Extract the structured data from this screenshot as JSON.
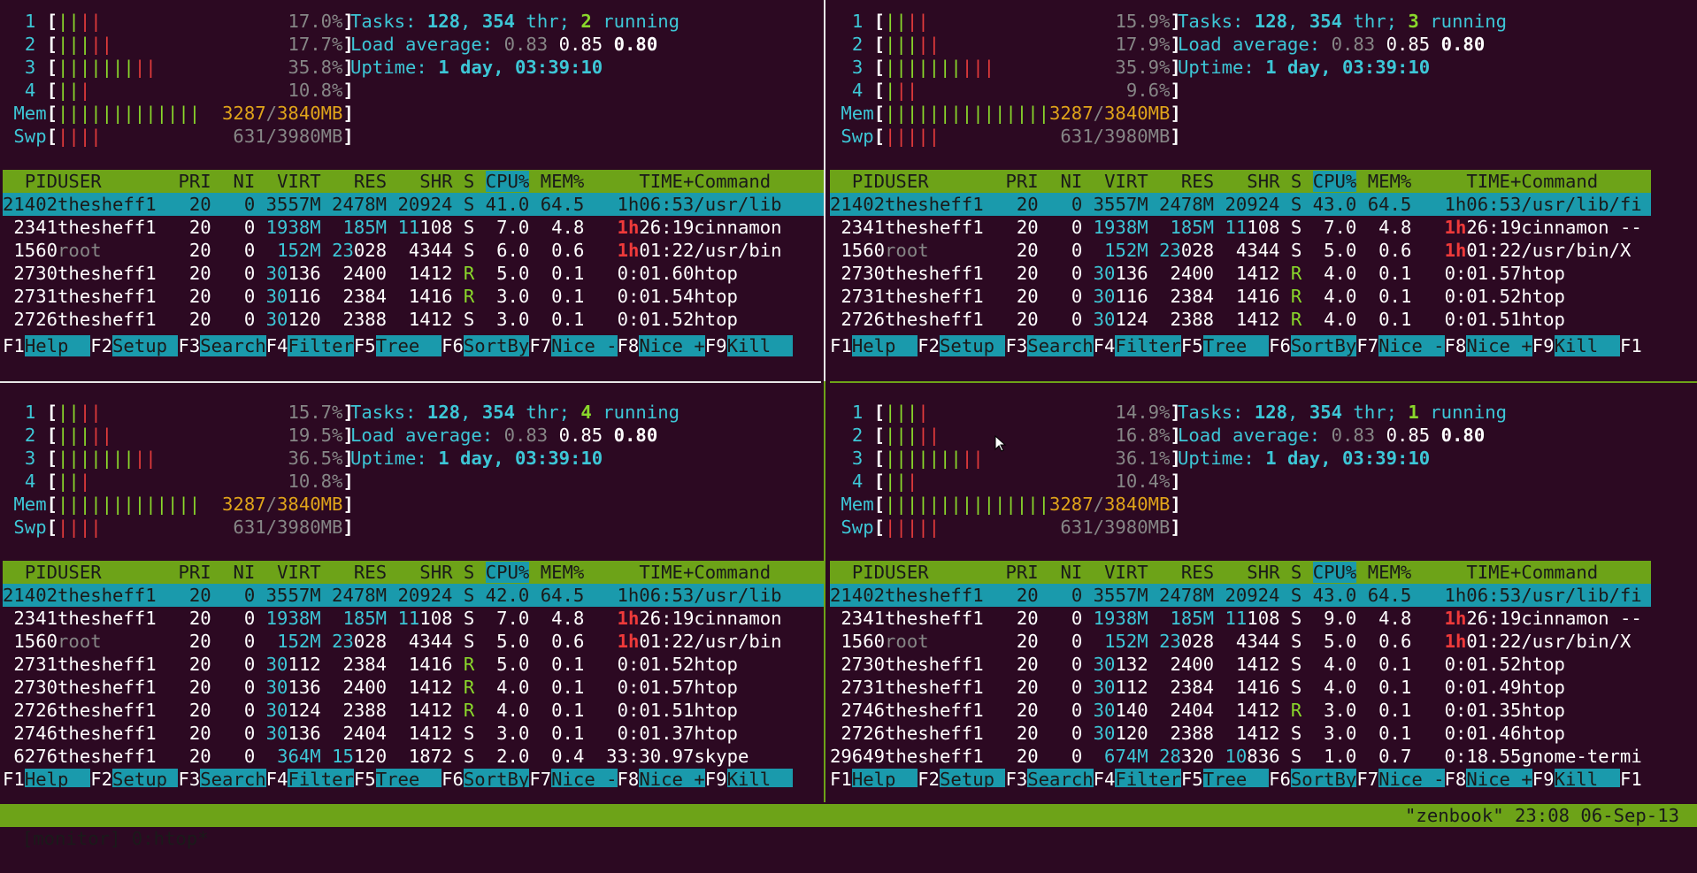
{
  "panes": [
    {
      "cpus": [
        {
          "num": "1",
          "bar": [
            [
              "g",
              "||"
            ],
            [
              "r",
              "||"
            ]
          ],
          "val": "17.0%"
        },
        {
          "num": "2",
          "bar": [
            [
              "g",
              "|||"
            ],
            [
              "r",
              "||"
            ]
          ],
          "val": "17.7%"
        },
        {
          "num": "3",
          "bar": [
            [
              "g",
              "|||||||"
            ],
            [
              "r",
              "||"
            ]
          ],
          "val": "35.8%"
        },
        {
          "num": "4",
          "bar": [
            [
              "g",
              "||"
            ],
            [
              "r",
              "|"
            ]
          ],
          "val": "10.8%"
        }
      ],
      "mem": {
        "label": "Mem",
        "bar": "|||||||||||||",
        "used": "3287",
        "sep": "/",
        "total": "3840",
        "unit": "MB"
      },
      "swp": {
        "label": "Swp",
        "bar": "||||",
        "val": "631/3980MB"
      },
      "tasks": {
        "label": "Tasks: ",
        "tasks": "128",
        "comma": ", ",
        "thr": "354",
        "thr_label": " thr; ",
        "running": "2",
        "running_label": " running"
      },
      "load": {
        "label": "Load average: ",
        "a1": "0.83",
        "a5": "0.85",
        "a15": "0.80"
      },
      "uptime": {
        "label": "Uptime: ",
        "val": "1 day, 03:39:10"
      },
      "rows": [
        {
          "pid": "21402",
          "user": "thesheff1",
          "pri": "20",
          "ni": "0",
          "virt": "3557M",
          "res": "2478M",
          "shr": "20924",
          "s": "S",
          "cpu": "41.0",
          "mem": "64.5",
          "time": "1h06:53",
          "cmd": "/usr/lib"
        },
        {
          "pid": "2341",
          "user": "thesheff1",
          "pri": "20",
          "ni": "0",
          "virt": "1938M",
          "res": "185M",
          "shr": "11108",
          "s": "S",
          "cpu": "7.0",
          "mem": "4.8",
          "time": "1h26:19",
          "cmd": "cinnamon"
        },
        {
          "pid": "1560",
          "user": "root",
          "pri": "20",
          "ni": "0",
          "virt": "152M",
          "res": "23028",
          "shr": "4344",
          "s": "S",
          "cpu": "6.0",
          "mem": "0.6",
          "time": "1h01:22",
          "cmd": "/usr/bin"
        },
        {
          "pid": "2730",
          "user": "thesheff1",
          "pri": "20",
          "ni": "0",
          "virt": "30136",
          "res": "2400",
          "shr": "1412",
          "s": "R",
          "cpu": "5.0",
          "mem": "0.1",
          "time": "0:01.60",
          "cmd": "htop"
        },
        {
          "pid": "2731",
          "user": "thesheff1",
          "pri": "20",
          "ni": "0",
          "virt": "30116",
          "res": "2384",
          "shr": "1416",
          "s": "R",
          "cpu": "3.0",
          "mem": "0.1",
          "time": "0:01.54",
          "cmd": "htop"
        },
        {
          "pid": "2726",
          "user": "thesheff1",
          "pri": "20",
          "ni": "0",
          "virt": "30120",
          "res": "2388",
          "shr": "1412",
          "s": "S",
          "cpu": "3.0",
          "mem": "0.1",
          "time": "0:01.52",
          "cmd": "htop"
        }
      ]
    },
    {
      "cpus": [
        {
          "num": "1",
          "bar": [
            [
              "g",
              "||"
            ],
            [
              "r",
              "||"
            ]
          ],
          "val": "15.9%"
        },
        {
          "num": "2",
          "bar": [
            [
              "g",
              "|||"
            ],
            [
              "r",
              "||"
            ]
          ],
          "val": "17.9%"
        },
        {
          "num": "3",
          "bar": [
            [
              "g",
              "|||||||"
            ],
            [
              "r",
              "|||"
            ]
          ],
          "val": "35.9%"
        },
        {
          "num": "4",
          "bar": [
            [
              "g",
              "|"
            ],
            [
              "r",
              "||"
            ]
          ],
          "val": "9.6%"
        }
      ],
      "mem": {
        "label": "Mem",
        "bar": "|||||||||||||||",
        "used": "3287",
        "sep": "/",
        "total": "3840",
        "unit": "MB"
      },
      "swp": {
        "label": "Swp",
        "bar": "|||||",
        "val": "631/3980MB"
      },
      "tasks": {
        "label": "Tasks: ",
        "tasks": "128",
        "comma": ", ",
        "thr": "354",
        "thr_label": " thr; ",
        "running": "3",
        "running_label": " running"
      },
      "load": {
        "label": "Load average: ",
        "a1": "0.83",
        "a5": "0.85",
        "a15": "0.80"
      },
      "uptime": {
        "label": "Uptime: ",
        "val": "1 day, 03:39:10"
      },
      "rows": [
        {
          "pid": "21402",
          "user": "thesheff1",
          "pri": "20",
          "ni": "0",
          "virt": "3557M",
          "res": "2478M",
          "shr": "20924",
          "s": "S",
          "cpu": "43.0",
          "mem": "64.5",
          "time": "1h06:53",
          "cmd": "/usr/lib/fi"
        },
        {
          "pid": "2341",
          "user": "thesheff1",
          "pri": "20",
          "ni": "0",
          "virt": "1938M",
          "res": "185M",
          "shr": "11108",
          "s": "S",
          "cpu": "7.0",
          "mem": "4.8",
          "time": "1h26:19",
          "cmd": "cinnamon --"
        },
        {
          "pid": "1560",
          "user": "root",
          "pri": "20",
          "ni": "0",
          "virt": "152M",
          "res": "23028",
          "shr": "4344",
          "s": "S",
          "cpu": "5.0",
          "mem": "0.6",
          "time": "1h01:22",
          "cmd": "/usr/bin/X"
        },
        {
          "pid": "2730",
          "user": "thesheff1",
          "pri": "20",
          "ni": "0",
          "virt": "30136",
          "res": "2400",
          "shr": "1412",
          "s": "R",
          "cpu": "4.0",
          "mem": "0.1",
          "time": "0:01.57",
          "cmd": "htop"
        },
        {
          "pid": "2731",
          "user": "thesheff1",
          "pri": "20",
          "ni": "0",
          "virt": "30116",
          "res": "2384",
          "shr": "1416",
          "s": "R",
          "cpu": "4.0",
          "mem": "0.1",
          "time": "0:01.52",
          "cmd": "htop"
        },
        {
          "pid": "2726",
          "user": "thesheff1",
          "pri": "20",
          "ni": "0",
          "virt": "30124",
          "res": "2388",
          "shr": "1412",
          "s": "R",
          "cpu": "4.0",
          "mem": "0.1",
          "time": "0:01.51",
          "cmd": "htop"
        }
      ]
    },
    {
      "cpus": [
        {
          "num": "1",
          "bar": [
            [
              "g",
              "||"
            ],
            [
              "r",
              "||"
            ]
          ],
          "val": "15.7%"
        },
        {
          "num": "2",
          "bar": [
            [
              "g",
              "|||"
            ],
            [
              "r",
              "||"
            ]
          ],
          "val": "19.5%"
        },
        {
          "num": "3",
          "bar": [
            [
              "g",
              "|||||||"
            ],
            [
              "r",
              "||"
            ]
          ],
          "val": "36.5%"
        },
        {
          "num": "4",
          "bar": [
            [
              "g",
              "||"
            ],
            [
              "r",
              "|"
            ]
          ],
          "val": "10.8%"
        }
      ],
      "mem": {
        "label": "Mem",
        "bar": "|||||||||||||",
        "used": "3287",
        "sep": "/",
        "total": "3840",
        "unit": "MB"
      },
      "swp": {
        "label": "Swp",
        "bar": "||||",
        "val": "631/3980MB"
      },
      "tasks": {
        "label": "Tasks: ",
        "tasks": "128",
        "comma": ", ",
        "thr": "354",
        "thr_label": " thr; ",
        "running": "4",
        "running_label": " running"
      },
      "load": {
        "label": "Load average: ",
        "a1": "0.83",
        "a5": "0.85",
        "a15": "0.80"
      },
      "uptime": {
        "label": "Uptime: ",
        "val": "1 day, 03:39:10"
      },
      "rows": [
        {
          "pid": "21402",
          "user": "thesheff1",
          "pri": "20",
          "ni": "0",
          "virt": "3557M",
          "res": "2478M",
          "shr": "20924",
          "s": "S",
          "cpu": "42.0",
          "mem": "64.5",
          "time": "1h06:53",
          "cmd": "/usr/lib"
        },
        {
          "pid": "2341",
          "user": "thesheff1",
          "pri": "20",
          "ni": "0",
          "virt": "1938M",
          "res": "185M",
          "shr": "11108",
          "s": "S",
          "cpu": "7.0",
          "mem": "4.8",
          "time": "1h26:19",
          "cmd": "cinnamon"
        },
        {
          "pid": "1560",
          "user": "root",
          "pri": "20",
          "ni": "0",
          "virt": "152M",
          "res": "23028",
          "shr": "4344",
          "s": "S",
          "cpu": "5.0",
          "mem": "0.6",
          "time": "1h01:22",
          "cmd": "/usr/bin"
        },
        {
          "pid": "2731",
          "user": "thesheff1",
          "pri": "20",
          "ni": "0",
          "virt": "30112",
          "res": "2384",
          "shr": "1416",
          "s": "R",
          "cpu": "5.0",
          "mem": "0.1",
          "time": "0:01.52",
          "cmd": "htop"
        },
        {
          "pid": "2730",
          "user": "thesheff1",
          "pri": "20",
          "ni": "0",
          "virt": "30136",
          "res": "2400",
          "shr": "1412",
          "s": "R",
          "cpu": "4.0",
          "mem": "0.1",
          "time": "0:01.57",
          "cmd": "htop"
        },
        {
          "pid": "2726",
          "user": "thesheff1",
          "pri": "20",
          "ni": "0",
          "virt": "30124",
          "res": "2388",
          "shr": "1412",
          "s": "R",
          "cpu": "4.0",
          "mem": "0.1",
          "time": "0:01.51",
          "cmd": "htop"
        },
        {
          "pid": "2746",
          "user": "thesheff1",
          "pri": "20",
          "ni": "0",
          "virt": "30136",
          "res": "2404",
          "shr": "1412",
          "s": "S",
          "cpu": "3.0",
          "mem": "0.1",
          "time": "0:01.37",
          "cmd": "htop"
        },
        {
          "pid": "6276",
          "user": "thesheff1",
          "pri": "20",
          "ni": "0",
          "virt": "364M",
          "res": "15120",
          "shr": "1872",
          "s": "S",
          "cpu": "2.0",
          "mem": "0.4",
          "time": "33:30.97",
          "cmd": "skype"
        }
      ]
    },
    {
      "cpus": [
        {
          "num": "1",
          "bar": [
            [
              "g",
              "|||"
            ],
            [
              "r",
              "|"
            ]
          ],
          "val": "14.9%"
        },
        {
          "num": "2",
          "bar": [
            [
              "g",
              "|||"
            ],
            [
              "r",
              "||"
            ]
          ],
          "val": "16.8%"
        },
        {
          "num": "3",
          "bar": [
            [
              "g",
              "|||||||"
            ],
            [
              "r",
              "||"
            ]
          ],
          "val": "36.1%"
        },
        {
          "num": "4",
          "bar": [
            [
              "g",
              "||"
            ],
            [
              "r",
              "|"
            ]
          ],
          "val": "10.4%"
        }
      ],
      "mem": {
        "label": "Mem",
        "bar": "|||||||||||||||",
        "used": "3287",
        "sep": "/",
        "total": "3840",
        "unit": "MB"
      },
      "swp": {
        "label": "Swp",
        "bar": "|||||",
        "val": "631/3980MB"
      },
      "tasks": {
        "label": "Tasks: ",
        "tasks": "128",
        "comma": ", ",
        "thr": "354",
        "thr_label": " thr; ",
        "running": "1",
        "running_label": " running"
      },
      "load": {
        "label": "Load average: ",
        "a1": "0.83",
        "a5": "0.85",
        "a15": "0.80"
      },
      "uptime": {
        "label": "Uptime: ",
        "val": "1 day, 03:39:10"
      },
      "rows": [
        {
          "pid": "21402",
          "user": "thesheff1",
          "pri": "20",
          "ni": "0",
          "virt": "3557M",
          "res": "2478M",
          "shr": "20924",
          "s": "S",
          "cpu": "43.0",
          "mem": "64.5",
          "time": "1h06:53",
          "cmd": "/usr/lib/fi"
        },
        {
          "pid": "2341",
          "user": "thesheff1",
          "pri": "20",
          "ni": "0",
          "virt": "1938M",
          "res": "185M",
          "shr": "11108",
          "s": "S",
          "cpu": "9.0",
          "mem": "4.8",
          "time": "1h26:19",
          "cmd": "cinnamon --"
        },
        {
          "pid": "1560",
          "user": "root",
          "pri": "20",
          "ni": "0",
          "virt": "152M",
          "res": "23028",
          "shr": "4344",
          "s": "S",
          "cpu": "5.0",
          "mem": "0.6",
          "time": "1h01:22",
          "cmd": "/usr/bin/X"
        },
        {
          "pid": "2730",
          "user": "thesheff1",
          "pri": "20",
          "ni": "0",
          "virt": "30132",
          "res": "2400",
          "shr": "1412",
          "s": "S",
          "cpu": "4.0",
          "mem": "0.1",
          "time": "0:01.52",
          "cmd": "htop"
        },
        {
          "pid": "2731",
          "user": "thesheff1",
          "pri": "20",
          "ni": "0",
          "virt": "30112",
          "res": "2384",
          "shr": "1416",
          "s": "S",
          "cpu": "4.0",
          "mem": "0.1",
          "time": "0:01.49",
          "cmd": "htop"
        },
        {
          "pid": "2746",
          "user": "thesheff1",
          "pri": "20",
          "ni": "0",
          "virt": "30140",
          "res": "2404",
          "shr": "1412",
          "s": "R",
          "cpu": "3.0",
          "mem": "0.1",
          "time": "0:01.35",
          "cmd": "htop"
        },
        {
          "pid": "2726",
          "user": "thesheff1",
          "pri": "20",
          "ni": "0",
          "virt": "30120",
          "res": "2388",
          "shr": "1412",
          "s": "S",
          "cpu": "3.0",
          "mem": "0.1",
          "time": "0:01.46",
          "cmd": "htop"
        },
        {
          "pid": "29649",
          "user": "thesheff1",
          "pri": "20",
          "ni": "0",
          "virt": "674M",
          "res": "28320",
          "shr": "10836",
          "s": "S",
          "cpu": "1.0",
          "mem": "0.7",
          "time": "0:18.55",
          "cmd": "gnome-termi"
        }
      ]
    }
  ],
  "header": {
    "pid": "PID",
    "user": "USER",
    "pri": "PRI",
    "ni": "NI",
    "virt": "VIRT",
    "res": "RES",
    "shr": "SHR",
    "s": "S",
    "cpu": "CPU%",
    "mem": "MEM%",
    "time": "TIME+",
    "cmd": "Command"
  },
  "fkeys": [
    {
      "key": "F1",
      "label": "Help  "
    },
    {
      "key": "F2",
      "label": "Setup "
    },
    {
      "key": "F3",
      "label": "Search"
    },
    {
      "key": "F4",
      "label": "Filter"
    },
    {
      "key": "F5",
      "label": "Tree  "
    },
    {
      "key": "F6",
      "label": "SortBy"
    },
    {
      "key": "F7",
      "label": "Nice -"
    },
    {
      "key": "F8",
      "label": "Nice +"
    },
    {
      "key": "F9",
      "label": "Kill  "
    }
  ],
  "fkeys_extra": {
    "key": "F1"
  },
  "status": {
    "left": "[monitor] 0:htop*",
    "right": "\"zenbook\" 23:08 06-Sep-13"
  },
  "colors": {
    "background": "#2c0922",
    "accent_green": "#6da318",
    "accent_cyan": "#1a9aac"
  }
}
